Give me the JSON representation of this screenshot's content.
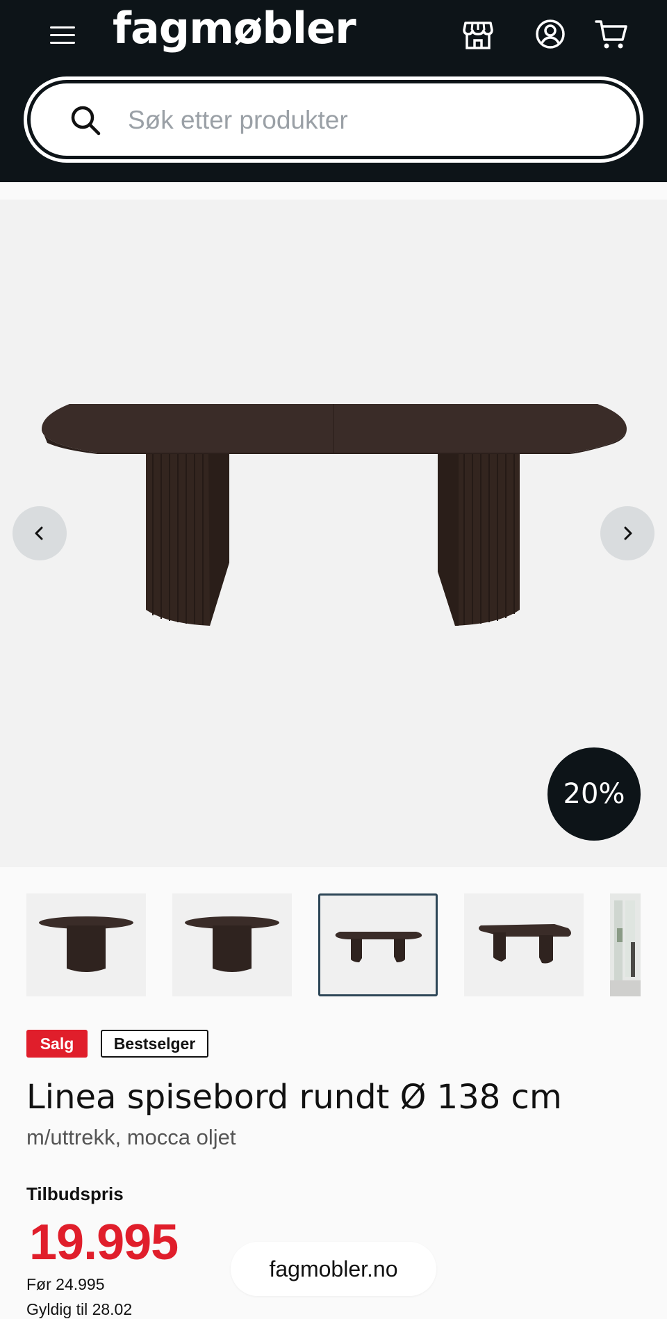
{
  "header": {
    "logo": "fagmøbler",
    "icons": [
      "menu-icon",
      "store-icon",
      "account-icon",
      "cart-icon"
    ]
  },
  "search": {
    "placeholder": "Søk etter produkter"
  },
  "gallery": {
    "discount_badge": "20%",
    "thumbnail_count": 5,
    "active_thumbnail": 3
  },
  "badges": {
    "sale": "Salg",
    "bestseller": "Bestselger"
  },
  "product": {
    "title": "Linea spisebord rundt Ø 138 cm",
    "subtitle": "m/uttrekk, mocca oljet",
    "offer_label": "Tilbudspris",
    "price": "19.995",
    "before_price": "Før 24.995",
    "valid_until": "Gyldig til 28.02"
  },
  "browser": {
    "domain": "fagmobler.no"
  },
  "colors": {
    "header_bg": "#0d1418",
    "sale_red": "#e01e2b",
    "table_wood": "#3a2c28"
  }
}
